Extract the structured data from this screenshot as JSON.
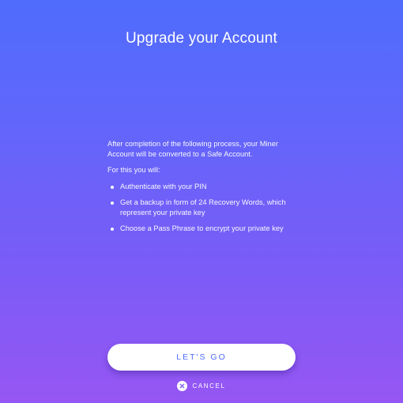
{
  "screen": {
    "title": "Upgrade your Account",
    "intro": "After completion of the following process, your Miner Account will be converted to a Safe Account.",
    "lead": "For this you will:",
    "steps": [
      "Authenticate with your PIN",
      "Get a backup in form of 24 Recovery Words, which represent your private key",
      "Choose a Pass Phrase to encrypt your private key"
    ]
  },
  "actions": {
    "primary_label": "LET'S GO",
    "cancel_label": "CANCEL",
    "cancel_icon": "close-circle-icon"
  },
  "colors": {
    "gradient_top": "#4f6cfd",
    "gradient_bottom": "#9656f3",
    "accent": "#4f6cfd"
  }
}
